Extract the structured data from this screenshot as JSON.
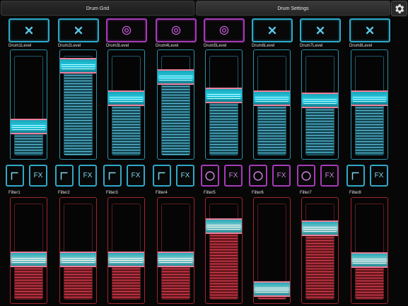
{
  "tabs": [
    {
      "label": "Drum Grid",
      "selected": false
    },
    {
      "label": "Drum Settings",
      "selected": true
    }
  ],
  "settings_icon": "gear-icon",
  "colors": {
    "blue": "#2fa8c8",
    "purple": "#a63ab8",
    "red": "#a02530",
    "thumb_border": "#ee7f9a"
  },
  "drums": [
    {
      "mode_icon": "x-icon",
      "mode_color": "blue",
      "level_label": "Drum1Level",
      "level": 0.3,
      "shape_icon": "corner-icon",
      "shape_color": "blue",
      "fx_label": "FX",
      "fx_color": "blue",
      "filter_label": "Filter1",
      "filter": 0.43
    },
    {
      "mode_icon": "x-icon",
      "mode_color": "blue",
      "level_label": "Drum2Level",
      "level": 0.9,
      "shape_icon": "corner-icon",
      "shape_color": "blue",
      "fx_label": "FX",
      "fx_color": "blue",
      "filter_label": "Filter2",
      "filter": 0.43
    },
    {
      "mode_icon": "power-icon",
      "mode_color": "purple",
      "level_label": "Drum3Level",
      "level": 0.58,
      "shape_icon": "corner-icon",
      "shape_color": "blue",
      "fx_label": "FX",
      "fx_color": "blue",
      "filter_label": "Filter3",
      "filter": 0.43
    },
    {
      "mode_icon": "power-icon",
      "mode_color": "purple",
      "level_label": "Drum4Level",
      "level": 0.79,
      "shape_icon": "corner-icon",
      "shape_color": "blue",
      "fx_label": "FX",
      "fx_color": "blue",
      "filter_label": "Filter4",
      "filter": 0.43
    },
    {
      "mode_icon": "power-icon",
      "mode_color": "purple",
      "level_label": "Drum5Level",
      "level": 0.61,
      "shape_icon": "circle-icon",
      "shape_color": "purple",
      "fx_label": "FX",
      "fx_color": "purple",
      "filter_label": "Filter5",
      "filter": 0.77
    },
    {
      "mode_icon": "x-icon",
      "mode_color": "blue",
      "level_label": "Drum6Level",
      "level": 0.58,
      "shape_icon": "circle-icon",
      "shape_color": "purple",
      "fx_label": "FX",
      "fx_color": "purple",
      "filter_label": "Filter6",
      "filter": 0.12
    },
    {
      "mode_icon": "x-icon",
      "mode_color": "blue",
      "level_label": "Drum7Level",
      "level": 0.56,
      "shape_icon": "circle-icon",
      "shape_color": "purple",
      "fx_label": "FX",
      "fx_color": "purple",
      "filter_label": "Filter7",
      "filter": 0.75
    },
    {
      "mode_icon": "x-icon",
      "mode_color": "blue",
      "level_label": "Drum8Level",
      "level": 0.58,
      "shape_icon": "corner-icon",
      "shape_color": "blue",
      "fx_label": "FX",
      "fx_color": "blue",
      "filter_label": "Filter8",
      "filter": 0.42
    }
  ]
}
